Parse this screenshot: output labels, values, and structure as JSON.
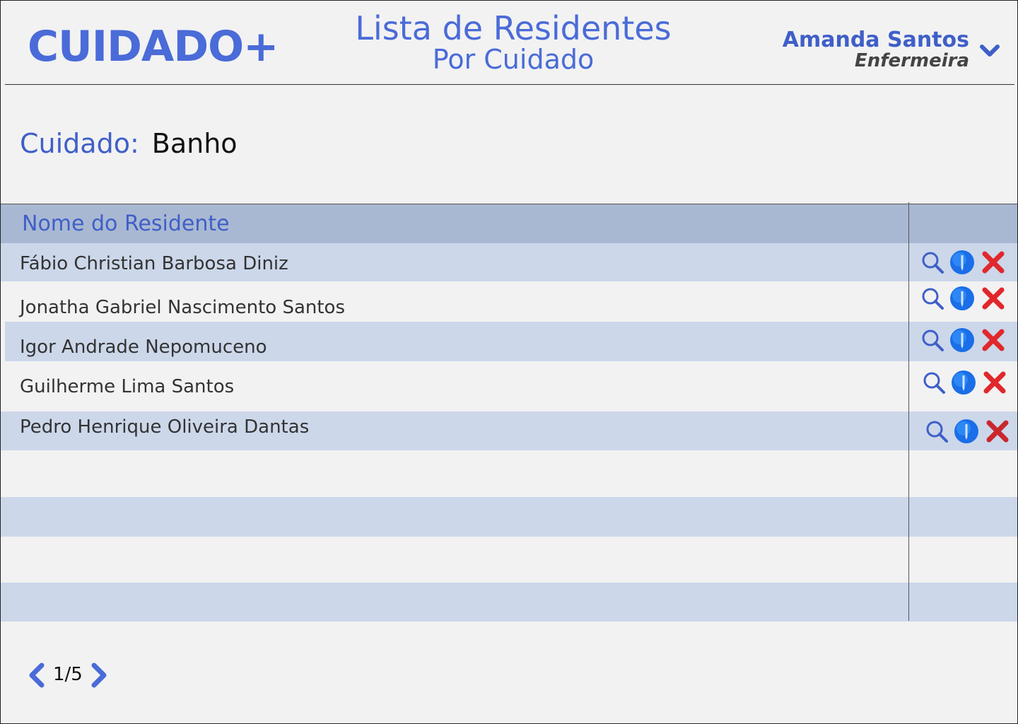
{
  "header": {
    "logo": "CUIDADO+",
    "title": "Lista de Residentes",
    "subtitle": "Por Cuidado",
    "user_name": "Amanda Santos",
    "user_role": "Enfermeira"
  },
  "filter": {
    "label": "Cuidado:",
    "value": "Banho"
  },
  "table": {
    "column_name": "Nome do Residente",
    "rows": [
      {
        "name": "Fábio Christian Barbosa Diniz"
      },
      {
        "name": "Jonatha Gabriel Nascimento Santos"
      },
      {
        "name": "Igor Andrade Nepomuceno"
      },
      {
        "name": "Guilherme Lima Santos"
      },
      {
        "name": "Pedro Henrique Oliveira Dantas"
      }
    ],
    "row_actions": [
      "search-icon",
      "edit-icon",
      "delete-icon"
    ]
  },
  "pagination": {
    "page": "1/5"
  },
  "colors": {
    "accent": "#4a6bd8",
    "header_row": "#a9b8d2",
    "alt_row": "#ccd7ea",
    "delete": "#e0282c",
    "edit": "#1a6ee8"
  }
}
